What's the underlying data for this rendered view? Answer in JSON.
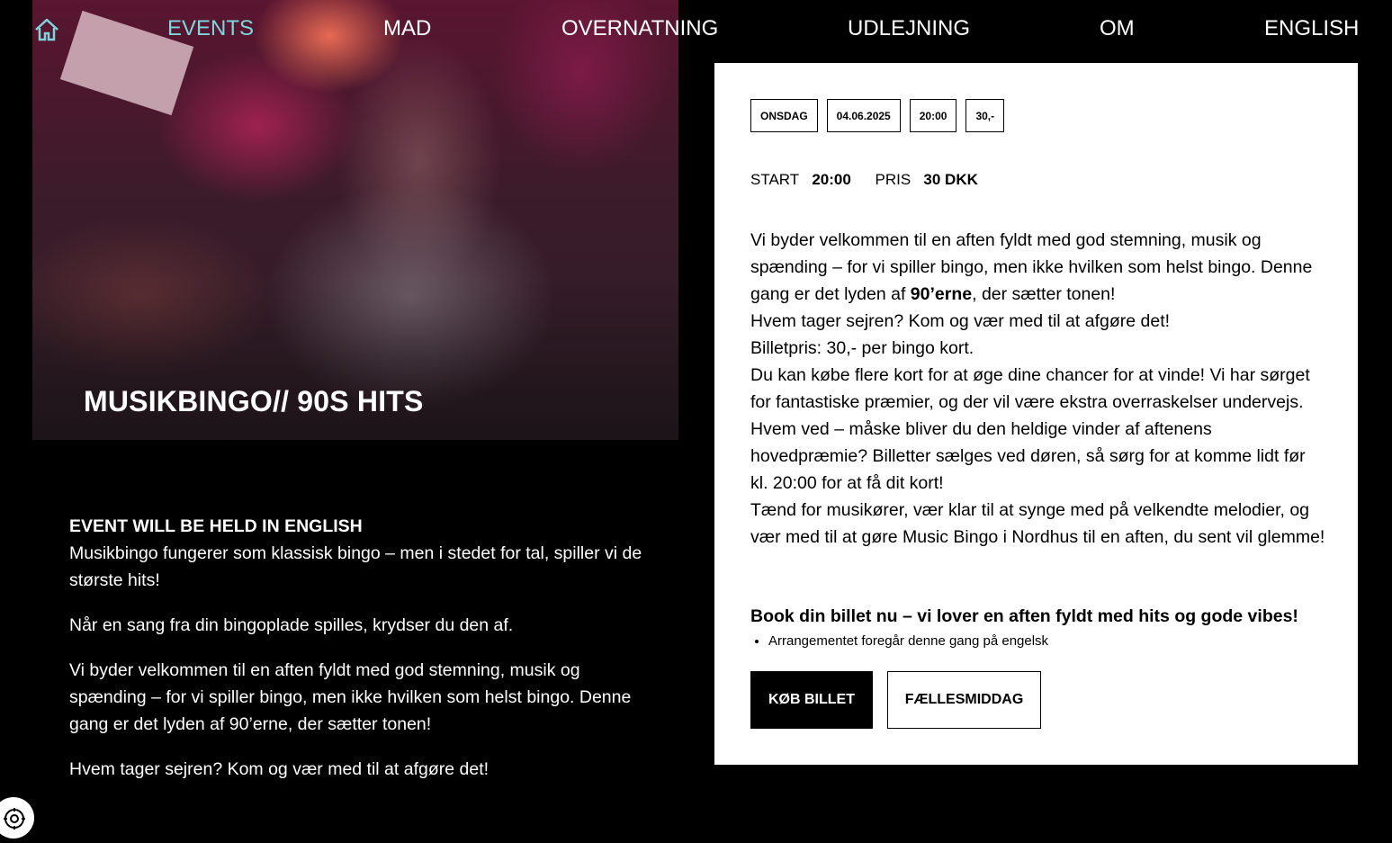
{
  "nav": {
    "home_icon": "home-icon",
    "items": [
      {
        "label": "EVENTS",
        "active": true
      },
      {
        "label": "MAD",
        "active": false
      },
      {
        "label": "OVERNATNING",
        "active": false
      },
      {
        "label": "UDLEJNING",
        "active": false
      },
      {
        "label": "OM",
        "active": false
      },
      {
        "label": "ENGLISH",
        "active": false
      }
    ],
    "active_color": "#7fd6dc"
  },
  "hero": {
    "title": "MUSIKBINGO// 90S HITS"
  },
  "left": {
    "note": "EVENT WILL BE HELD IN ENGLISH",
    "intro": "Musikbingo fungerer som klassisk bingo – men i stedet for tal, spiller vi de største hits!",
    "p2": "Når en sang fra din bingoplade spilles, krydser du den af.",
    "p3": "Vi byder velkommen til en aften fyldt med god stemning, musik og spænding – for vi spiller bingo, men ikke hvilken som helst bingo. Denne gang er det lyden af 90’erne, der sætter tonen!",
    "p4": "Hvem tager sejren? Kom og vær med til at afgøre det!"
  },
  "card": {
    "tags": [
      "ONSDAG",
      "04.06.2025",
      "20:00",
      "30,-"
    ],
    "start_label": "START",
    "start_value": "20:00",
    "price_label": "PRIS",
    "price_value": "30 DKK",
    "desc_1a": "Vi byder velkommen til en aften fyldt med god stemning, musik og spænding – for vi spiller bingo, men ikke hvilken som helst bingo. Denne gang er det lyden af ",
    "desc_1b": "90’erne",
    "desc_1c": ", der sætter tonen!",
    "desc_2": "Hvem tager sejren? Kom og vær med til at afgøre det!",
    "desc_3": "Billetpris: 30,- per bingo kort.",
    "desc_4": "Du kan købe flere kort for at øge dine chancer for at vinde! Vi har sørget for fantastiske præmier, og der vil være ekstra overraskelser undervejs. Hvem ved – måske bliver du den heldige vinder af aftenens hovedpræmie? Billetter sælges ved døren, så sørg for at komme lidt før kl. 20:00 for at få dit kort!",
    "desc_5": "Tænd for musikører, vær klar til at synge med på velkendte melodier, og vær med til at gøre Music Bingo i Nordhus til en aften, du sent vil glemme!",
    "book": "Book din billet nu – vi lover en aften fyldt med hits og gode vibes!",
    "bullet": "Arrangementet foregår denne gang på engelsk",
    "buy_label": "KØB BILLET",
    "dinner_label": "FÆLLESMIDDAG"
  },
  "corner_badge_icon": "cookie-settings-icon"
}
